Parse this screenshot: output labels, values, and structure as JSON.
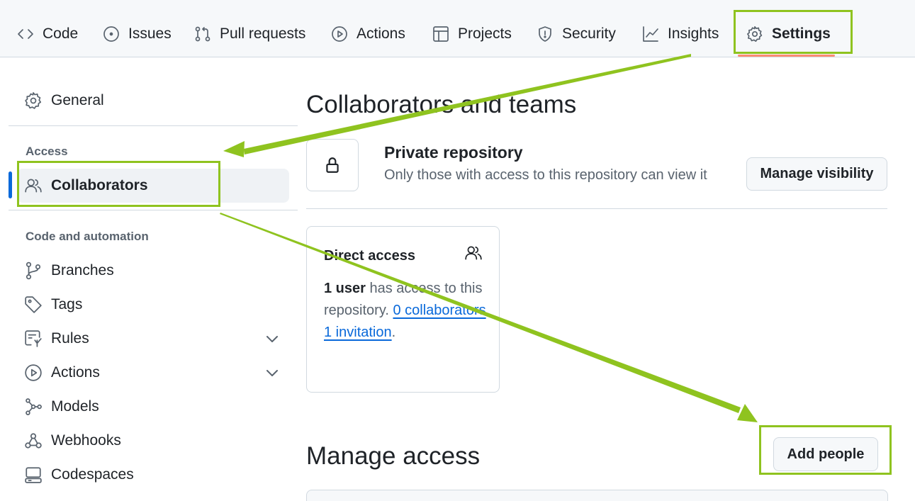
{
  "repo_nav": {
    "tabs": [
      {
        "label": "Code",
        "icon": "code-icon"
      },
      {
        "label": "Issues",
        "icon": "issue-icon"
      },
      {
        "label": "Pull requests",
        "icon": "pull-request-icon"
      },
      {
        "label": "Actions",
        "icon": "play-icon"
      },
      {
        "label": "Projects",
        "icon": "table-icon"
      },
      {
        "label": "Security",
        "icon": "shield-icon"
      },
      {
        "label": "Insights",
        "icon": "graph-icon"
      },
      {
        "label": "Settings",
        "icon": "gear-icon",
        "selected": true
      }
    ]
  },
  "sidebar": {
    "general": "General",
    "access_heading": "Access",
    "collaborators": "Collaborators",
    "code_heading": "Code and automation",
    "items": [
      "Branches",
      "Tags",
      "Rules",
      "Actions",
      "Models",
      "Webhooks",
      "Codespaces"
    ]
  },
  "main": {
    "title": "Collaborators and teams",
    "visibility": {
      "title": "Private repository",
      "description": "Only those with access to this repository can view it",
      "button": "Manage visibility"
    },
    "direct_access": {
      "title": "Direct access",
      "user_count": "1 user",
      "text_a": " has access to this repository. ",
      "collaborators_link": "0 collaborators",
      "sep": ". ",
      "invitation_link": "1 invitation",
      "end": "."
    },
    "manage_access": {
      "title": "Manage access",
      "button": "Add people"
    }
  },
  "colors": {
    "annotation": "#8fc31f",
    "accent": "#0969da",
    "tab_underline": "#fd8c73"
  }
}
